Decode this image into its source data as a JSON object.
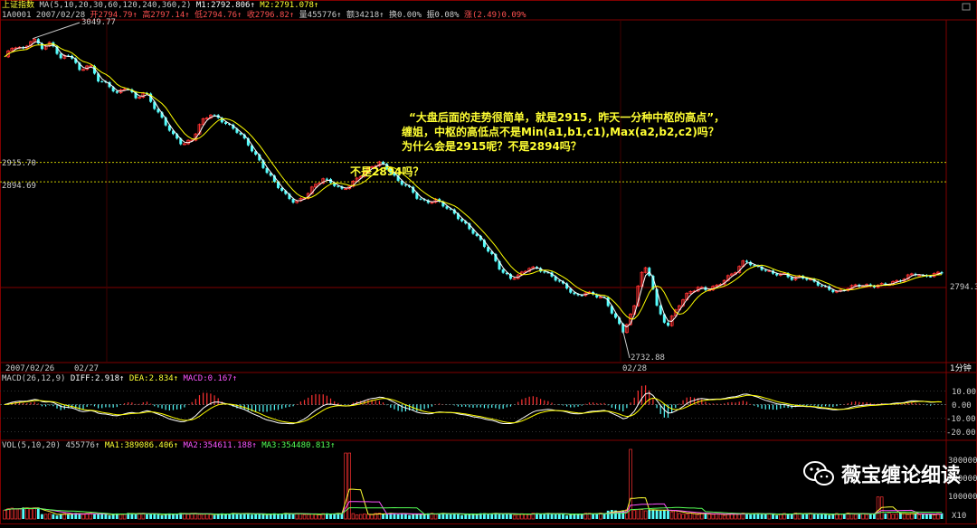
{
  "header": {
    "index_name": "上证指数",
    "ma_params": "MA(5,10,20,30,60,120,240,360,2)",
    "m1": "M1:2792.806↑",
    "m2": "M2:2791.078↑",
    "code_date": "1A0001  2007/02/28",
    "open": "开2794.79↑",
    "high": "高2797.14↑",
    "low": "低2794.76↑",
    "close": "收2796.82↑",
    "vol": "量455776↑",
    "amount": "额34218↑",
    "turnover": "换0.00%",
    "amplitude": "振0.08%",
    "change": "涨(2.49)0.09%"
  },
  "price_labels": {
    "hi": "3049.77",
    "lo": "2732.88",
    "last": "2794.3",
    "l2915": "2915.70",
    "l2894": "2894.69"
  },
  "annotation": {
    "line1": "“大盘后面的走势很简单，就是2915，昨天一分种中枢的高点”，",
    "line2": "缠姐，中枢的高低点不是Min(a1,b1,c1),Max(a2,b2,c2)吗？",
    "line3": "为什么会是2915呢？不是2894吗？",
    "mid": "不是2894吗？"
  },
  "time_axis": {
    "d1": "2007/02/26",
    "d2": "02/27",
    "d3": "02/28",
    "period": "1分钟"
  },
  "macd": {
    "params": "MACD(26,12,9)",
    "diff": "DIFF:2.918↑",
    "dea": "DEA:2.834↑",
    "macd": "MACD:0.167↑",
    "ticks": [
      "10.00",
      "0.00",
      "-10.00",
      "-20.00"
    ]
  },
  "volume": {
    "params": "VOL(5,10,20)",
    "value": "455776↑",
    "ma1": "MA1:389086.406↑",
    "ma2": "MA2:354611.188↑",
    "ma3": "MA3:354480.813↑",
    "ticks": [
      "300000",
      "200000",
      "100000"
    ],
    "unit": "X10"
  },
  "watermark": "薇宝缠论细读",
  "colors": {
    "bg": "#000000",
    "up": "#ff3232",
    "down": "#54fcfc",
    "ma_white": "#ffffff",
    "ma_yellow": "#ffff00",
    "grid_red": "#800000",
    "ref_line": "#c8c800"
  },
  "chart_data": [
    {
      "type": "candlestick",
      "title": "上证指数",
      "x": [
        "2007/02/26",
        "02/27",
        "02/28"
      ],
      "y_refs": [
        3049.77,
        2915.7,
        2894.69,
        2794.3,
        2732.88
      ],
      "ylim": [
        2700,
        3070
      ],
      "path_points": [
        [
          0,
          3030
        ],
        [
          5,
          3042
        ],
        [
          10,
          3038
        ],
        [
          15,
          3049.77
        ],
        [
          20,
          3040
        ],
        [
          25,
          3045
        ],
        [
          30,
          3028
        ],
        [
          35,
          3033
        ],
        [
          40,
          3015
        ],
        [
          45,
          3022
        ],
        [
          50,
          3005
        ],
        [
          55,
          3000
        ],
        [
          60,
          2990
        ],
        [
          65,
          2998
        ],
        [
          70,
          2985
        ],
        [
          75,
          2992
        ],
        [
          80,
          2975
        ],
        [
          85,
          2960
        ],
        [
          90,
          2945
        ],
        [
          95,
          2935
        ],
        [
          100,
          2940
        ],
        [
          105,
          2960
        ],
        [
          110,
          2968
        ],
        [
          115,
          2962
        ],
        [
          120,
          2955
        ],
        [
          125,
          2948
        ],
        [
          130,
          2935
        ],
        [
          135,
          2920
        ],
        [
          140,
          2905
        ],
        [
          145,
          2892
        ],
        [
          150,
          2880
        ],
        [
          155,
          2872
        ],
        [
          160,
          2878
        ],
        [
          165,
          2890
        ],
        [
          170,
          2898
        ],
        [
          175,
          2893
        ],
        [
          180,
          2886
        ],
        [
          185,
          2892
        ],
        [
          190,
          2902
        ],
        [
          195,
          2910
        ],
        [
          200,
          2915.7
        ],
        [
          205,
          2908
        ],
        [
          210,
          2895
        ],
        [
          215,
          2890
        ],
        [
          220,
          2878
        ],
        [
          225,
          2872
        ],
        [
          230,
          2875
        ],
        [
          235,
          2868
        ],
        [
          240,
          2860
        ],
        [
          245,
          2850
        ],
        [
          250,
          2840
        ],
        [
          255,
          2828
        ],
        [
          260,
          2815
        ],
        [
          265,
          2798
        ],
        [
          270,
          2790
        ],
        [
          275,
          2794
        ],
        [
          280,
          2802
        ],
        [
          285,
          2800
        ],
        [
          290,
          2795
        ],
        [
          295,
          2788
        ],
        [
          300,
          2780
        ],
        [
          305,
          2770
        ],
        [
          310,
          2775
        ],
        [
          315,
          2772
        ],
        [
          320,
          2768
        ],
        [
          325,
          2750
        ],
        [
          330,
          2732.88
        ],
        [
          333,
          2745
        ],
        [
          336,
          2760
        ],
        [
          339,
          2795
        ],
        [
          342,
          2800
        ],
        [
          345,
          2790
        ],
        [
          348,
          2760
        ],
        [
          351,
          2745
        ],
        [
          354,
          2740
        ],
        [
          357,
          2752
        ],
        [
          360,
          2762
        ],
        [
          365,
          2775
        ],
        [
          370,
          2780
        ],
        [
          375,
          2778
        ],
        [
          380,
          2782
        ],
        [
          385,
          2790
        ],
        [
          390,
          2798
        ],
        [
          395,
          2810
        ],
        [
          400,
          2803
        ],
        [
          405,
          2800
        ],
        [
          410,
          2795
        ],
        [
          415,
          2795
        ],
        [
          420,
          2790
        ],
        [
          425,
          2792
        ],
        [
          430,
          2788
        ],
        [
          435,
          2783
        ],
        [
          440,
          2778
        ],
        [
          445,
          2775
        ],
        [
          450,
          2780
        ],
        [
          455,
          2783
        ],
        [
          460,
          2782
        ],
        [
          465,
          2782
        ],
        [
          470,
          2784
        ],
        [
          475,
          2786
        ],
        [
          480,
          2790
        ],
        [
          485,
          2796
        ],
        [
          490,
          2792
        ],
        [
          495,
          2794
        ],
        [
          500,
          2796.82
        ]
      ]
    },
    {
      "type": "bar",
      "title": "MACD(26,12,9)",
      "series": [
        {
          "name": "DIFF",
          "last": 2.918
        },
        {
          "name": "DEA",
          "last": 2.834
        },
        {
          "name": "MACD",
          "last": 0.167
        }
      ],
      "ylim": [
        -25,
        15
      ]
    },
    {
      "type": "bar",
      "title": "VOL(5,10,20)",
      "series": [
        {
          "name": "MA1",
          "last": 389086.406
        },
        {
          "name": "MA2",
          "last": 354611.188
        },
        {
          "name": "MA3",
          "last": 354480.813
        }
      ],
      "last_volume": 455776,
      "ylim": [
        0,
        380000
      ],
      "spikes": [
        [
          183,
          360000
        ],
        [
          334,
          380000
        ],
        [
          467,
          120000
        ]
      ]
    }
  ]
}
